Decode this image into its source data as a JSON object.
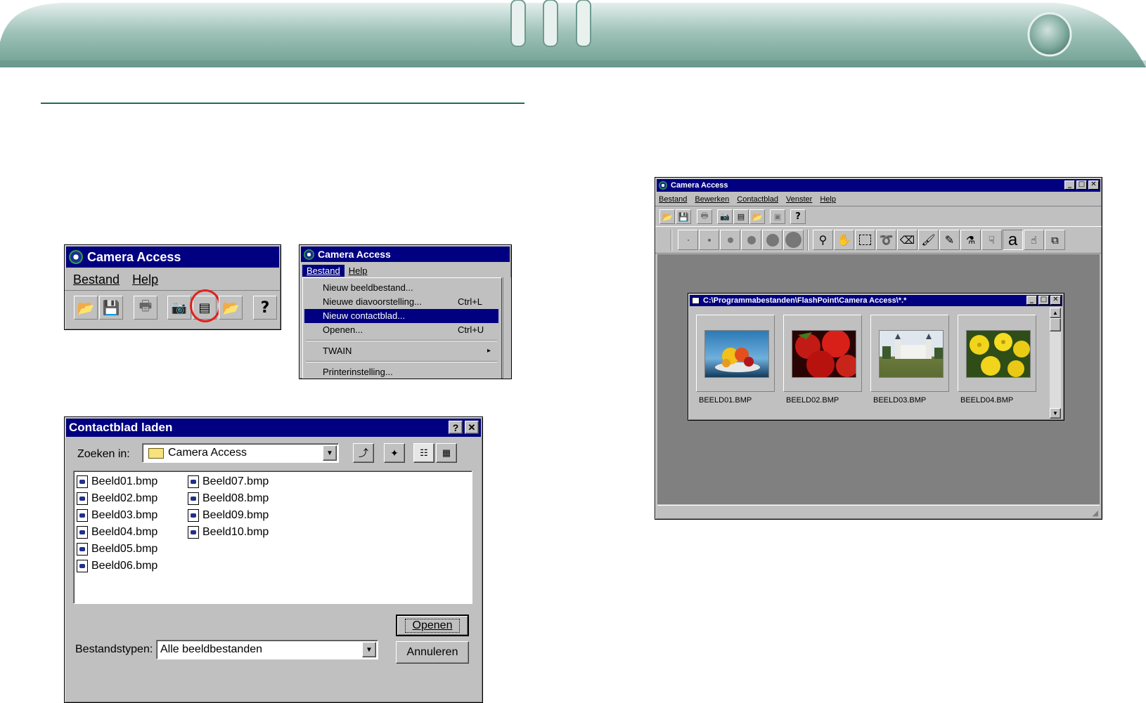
{
  "colors": {
    "accent_green": "#1e6d55",
    "win_blue": "#000080",
    "face": "#c0c0c0",
    "workspace": "#808080"
  },
  "small_app": {
    "title": "Camera Access",
    "menu": [
      "Bestand",
      "Help"
    ],
    "toolbar_icons": [
      "open-folder-icon",
      "save-icon",
      "print-icon",
      "camera-icon",
      "contact-sheet-icon",
      "open-album-icon",
      "help-icon"
    ],
    "highlighted_icon": "contact-sheet-icon"
  },
  "menu_app": {
    "title": "Camera Access",
    "menu": [
      "Bestand",
      "Help"
    ],
    "items": [
      {
        "label": "Nieuw beeldbestand...",
        "shortcut": ""
      },
      {
        "label": "Nieuwe diavoorstelling...",
        "shortcut": "Ctrl+L"
      },
      {
        "label": "Nieuw contactblad...",
        "shortcut": ""
      },
      {
        "label": "Openen...",
        "shortcut": "Ctrl+U"
      },
      {
        "label": "TWAIN",
        "shortcut": "▸"
      },
      {
        "label": "Printerinstelling...",
        "shortcut": ""
      }
    ],
    "selected_index": 2
  },
  "dialog": {
    "title": "Contactblad laden",
    "help_btn": "?",
    "close_btn": "✕",
    "look_in_label": "Zoeken in:",
    "look_in_value": "Camera Access",
    "files_col1": [
      "Beeld01.bmp",
      "Beeld02.bmp",
      "Beeld03.bmp",
      "Beeld04.bmp",
      "Beeld05.bmp",
      "Beeld06.bmp"
    ],
    "files_col2": [
      "Beeld07.bmp",
      "Beeld08.bmp",
      "Beeld09.bmp",
      "Beeld10.bmp"
    ],
    "filetype_label": "Bestandstypen:",
    "filetype_value": "Alle beeldbestanden",
    "open_btn": "Openen",
    "cancel_btn": "Annuleren"
  },
  "main_app": {
    "title": "Camera Access",
    "menu": [
      "Bestand",
      "Bewerken",
      "Contactblad",
      "Venster",
      "Help"
    ],
    "caption_buttons": [
      "_",
      "□",
      "✕"
    ],
    "toolbar1_icons": [
      "open-folder-icon",
      "save-icon",
      "print-icon",
      "camera-icon",
      "contact-sheet-icon",
      "open-album-icon",
      "slideshow-icon",
      "help-icon"
    ],
    "toolbar2_icons": [
      "brush-size-1-icon",
      "brush-size-2-icon",
      "brush-size-3-icon",
      "brush-size-4-icon",
      "brush-size-5-icon",
      "brush-size-6-icon",
      "zoom-icon",
      "hand-icon",
      "rect-select-icon",
      "lasso-icon",
      "eraser-icon",
      "brush-icon",
      "pencil-icon",
      "eyedropper-icon",
      "fill-icon",
      "text-icon",
      "smudge-icon",
      "clone-icon"
    ],
    "text_tool_glyph": "a",
    "child": {
      "title": "C:\\Programmabestanden\\FlashPoint\\Camera Access\\*.*",
      "thumbnails": [
        {
          "label": "BEELD01.BMP",
          "subject": "fruit-bowl"
        },
        {
          "label": "BEELD02.BMP",
          "subject": "strawberries"
        },
        {
          "label": "BEELD03.BMP",
          "subject": "castle"
        },
        {
          "label": "BEELD04.BMP",
          "subject": "yellow-flowers"
        }
      ]
    }
  }
}
